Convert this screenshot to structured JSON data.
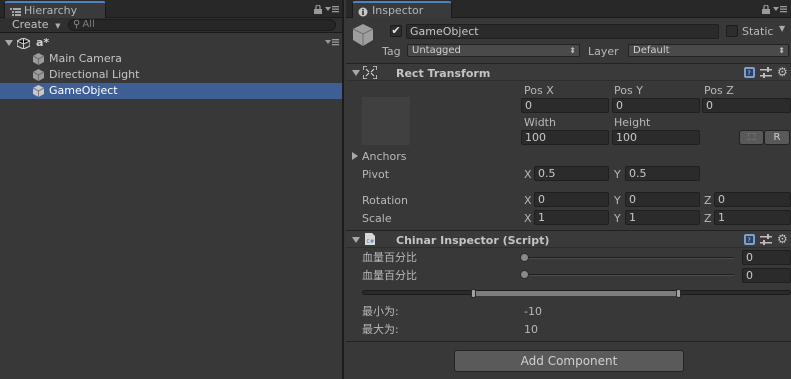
{
  "hierarchy": {
    "tab_label": "Hierarchy",
    "create_label": "Create",
    "search_placeholder": "All",
    "scene_name": "a*",
    "items": [
      {
        "label": "Main Camera",
        "selected": false
      },
      {
        "label": "Directional Light",
        "selected": false
      },
      {
        "label": "GameObject",
        "selected": true
      }
    ]
  },
  "inspector": {
    "tab_label": "Inspector",
    "object_name": "GameObject",
    "static_label": "Static",
    "tag_label": "Tag",
    "tag_value": "Untagged",
    "layer_label": "Layer",
    "layer_value": "Default",
    "rect_transform": {
      "title": "Rect Transform",
      "posx_label": "Pos X",
      "posy_label": "Pos Y",
      "posz_label": "Pos Z",
      "posx": "0",
      "posy": "0",
      "posz": "0",
      "width_label": "Width",
      "height_label": "Height",
      "width": "100",
      "height": "100",
      "r_button": "R",
      "anchors_label": "Anchors",
      "pivot_label": "Pivot",
      "pivot_x": "0.5",
      "pivot_y": "0.5",
      "rotation_label": "Rotation",
      "rot_x": "0",
      "rot_y": "0",
      "rot_z": "0",
      "scale_label": "Scale",
      "scale_x": "1",
      "scale_y": "1",
      "scale_z": "1",
      "x": "X",
      "y": "Y",
      "z": "Z"
    },
    "script": {
      "title": "Chinar Inspector (Script)",
      "slider1_label": "血量百分比",
      "slider1_value": "0",
      "slider1_fraction": 0.0,
      "slider2_label": "血量百分比",
      "slider2_value": "0",
      "slider2_fraction": 0.0,
      "minmax_low_fraction": 0.26,
      "minmax_high_fraction": 0.74,
      "min_label": "最小为:",
      "min_value": "-10",
      "max_label": "最大为:",
      "max_value": "10"
    },
    "add_component": "Add Component"
  },
  "colors": {
    "selection": "#3e5f96",
    "tab_accent": "#4d82c4",
    "panel": "#383838",
    "field": "#2b2b2b"
  }
}
